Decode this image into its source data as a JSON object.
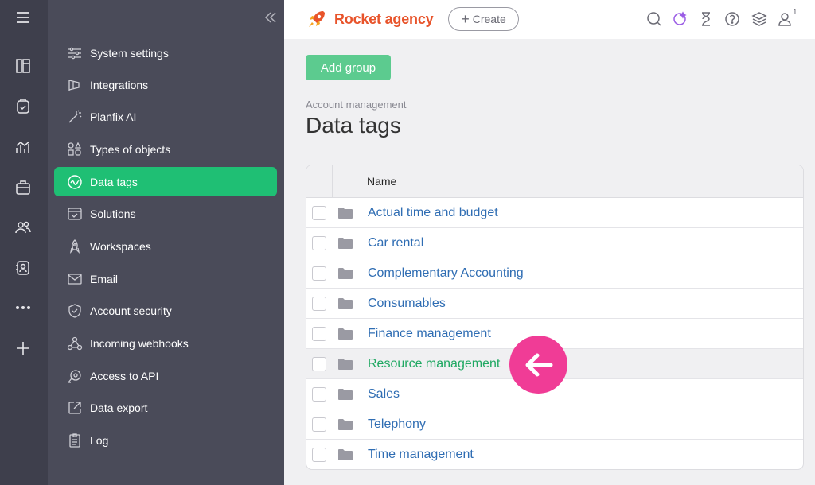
{
  "app": {
    "brand": "Rocket agency",
    "create_label": "Create",
    "notification_count": "1"
  },
  "rail": {
    "icons": [
      "menu-icon",
      "books-icon",
      "task-icon",
      "chart-icon",
      "briefcase-icon",
      "people-icon",
      "contact-icon",
      "more-icon",
      "plus-icon"
    ]
  },
  "sidebar": {
    "items": [
      {
        "label": "System settings",
        "icon": "sliders-icon"
      },
      {
        "label": "Integrations",
        "icon": "plug-icon"
      },
      {
        "label": "Planfix AI",
        "icon": "magic-wand-icon"
      },
      {
        "label": "Types of objects",
        "icon": "shapes-icon"
      },
      {
        "label": "Data tags",
        "icon": "wave-icon",
        "active": true
      },
      {
        "label": "Solutions",
        "icon": "checkbox-icon"
      },
      {
        "label": "Workspaces",
        "icon": "rocket-icon"
      },
      {
        "label": "Email",
        "icon": "envelope-icon"
      },
      {
        "label": "Account security",
        "icon": "shield-icon"
      },
      {
        "label": "Incoming webhooks",
        "icon": "webhook-icon"
      },
      {
        "label": "Access to API",
        "icon": "api-icon"
      },
      {
        "label": "Data export",
        "icon": "export-icon"
      },
      {
        "label": "Log",
        "icon": "clipboard-icon"
      }
    ]
  },
  "main": {
    "add_group_label": "Add group",
    "breadcrumb": "Account management",
    "title": "Data tags",
    "table": {
      "column_name": "Name",
      "rows": [
        "Actual time and budget",
        "Car rental",
        "Complementary Accounting",
        "Consumables",
        "Finance management",
        "Resource management",
        "Sales",
        "Telephony",
        "Time management"
      ],
      "highlighted_row": "Resource management"
    }
  },
  "colors": {
    "accent": "#1fbf74",
    "brand": "#e8542b",
    "pointer": "#f03c96",
    "link": "#2f6db3"
  }
}
